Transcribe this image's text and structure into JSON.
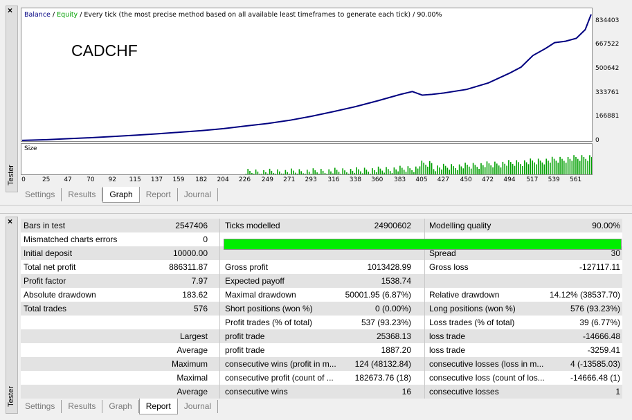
{
  "top_panel": {
    "close_glyph": "×",
    "side_label": "Tester",
    "legend": {
      "balance": "Balance",
      "slash": " / ",
      "equity": "Equity",
      "rest": " / Every tick (the most precise method based on all available least timeframes to generate each tick) / 90.00%"
    },
    "symbol": "CADCHF",
    "volume_label": "Size",
    "tabs": [
      "Settings",
      "Results",
      "Graph",
      "Report",
      "Journal"
    ],
    "active_tab": "Graph"
  },
  "bottom_panel": {
    "close_glyph": "×",
    "side_label": "Tester",
    "tabs": [
      "Settings",
      "Results",
      "Graph",
      "Report",
      "Journal"
    ],
    "active_tab": "Report"
  },
  "colors": {
    "balance": "#000080",
    "equity": "#00a000",
    "volume": "#00a000",
    "quality_bar": "#00ee00"
  },
  "chart_data": {
    "type": "line",
    "title": "",
    "y_ticks": [
      "834403",
      "667522",
      "500642",
      "333761",
      "166881",
      "0"
    ],
    "ylim": [
      0,
      900000
    ],
    "x_ticks": [
      "0",
      "25",
      "47",
      "70",
      "92",
      "115",
      "137",
      "159",
      "182",
      "204",
      "226",
      "249",
      "271",
      "293",
      "316",
      "338",
      "360",
      "383",
      "405",
      "427",
      "450",
      "472",
      "494",
      "517",
      "539",
      "561"
    ],
    "xlim": [
      0,
      576
    ],
    "series": [
      {
        "name": "Balance",
        "x": [
          0,
          25,
          47,
          70,
          92,
          115,
          137,
          159,
          182,
          204,
          226,
          249,
          271,
          293,
          316,
          338,
          360,
          383,
          395,
          405,
          415,
          427,
          450,
          472,
          494,
          505,
          517,
          530,
          539,
          550,
          561,
          570,
          576
        ],
        "y": [
          10000,
          15000,
          22000,
          29000,
          37000,
          46000,
          56000,
          67000,
          78000,
          92000,
          110000,
          128000,
          150000,
          178000,
          212000,
          246000,
          286000,
          330000,
          350000,
          325000,
          330000,
          340000,
          365000,
          410000,
          480000,
          520000,
          600000,
          650000,
          690000,
          700000,
          720000,
          780000,
          886312
        ]
      }
    ],
    "volume_start_index": 226
  },
  "report": {
    "rows": [
      {
        "shade": true,
        "cells": [
          "Bars in test",
          "2547406",
          "Ticks modelled",
          "24900602",
          "Modelling quality",
          "90.00%"
        ]
      },
      {
        "shade": false,
        "cells": [
          "Mismatched charts errors",
          "0",
          "",
          "",
          "",
          ""
        ]
      },
      {
        "shade": true,
        "cells": [
          "Initial deposit",
          "10000.00",
          "",
          "",
          "Spread",
          "30"
        ]
      },
      {
        "shade": false,
        "cells": [
          "Total net profit",
          "886311.87",
          "Gross profit",
          "1013428.99",
          "Gross loss",
          "-127117.11"
        ]
      },
      {
        "shade": true,
        "cells": [
          "Profit factor",
          "7.97",
          "Expected payoff",
          "1538.74",
          "",
          ""
        ]
      },
      {
        "shade": false,
        "cells": [
          "Absolute drawdown",
          "183.62",
          "Maximal drawdown",
          "50001.95 (6.87%)",
          "Relative drawdown",
          "14.12% (38537.70)"
        ]
      },
      {
        "shade": true,
        "cells": [
          "Total trades",
          "576",
          "Short positions (won %)",
          "0 (0.00%)",
          "Long positions (won %)",
          "576 (93.23%)"
        ]
      },
      {
        "shade": false,
        "cells": [
          "",
          "",
          "Profit trades (% of total)",
          "537 (93.23%)",
          "Loss trades (% of total)",
          "39 (6.77%)"
        ]
      },
      {
        "shade": true,
        "cells": [
          "",
          "Largest",
          "profit trade",
          "25368.13",
          "loss trade",
          "-14666.48"
        ]
      },
      {
        "shade": false,
        "cells": [
          "",
          "Average",
          "profit trade",
          "1887.20",
          "loss trade",
          "-3259.41"
        ]
      },
      {
        "shade": true,
        "cells": [
          "",
          "Maximum",
          "consecutive wins (profit in m...",
          "124 (48132.84)",
          "consecutive losses (loss in m...",
          "4 (-13585.03)"
        ]
      },
      {
        "shade": false,
        "cells": [
          "",
          "Maximal",
          "consecutive profit (count of ...",
          "182673.76 (18)",
          "consecutive loss (count of los...",
          "-14666.48 (1)"
        ]
      },
      {
        "shade": true,
        "cells": [
          "",
          "Average",
          "consecutive wins",
          "16",
          "consecutive losses",
          "1"
        ]
      }
    ]
  }
}
